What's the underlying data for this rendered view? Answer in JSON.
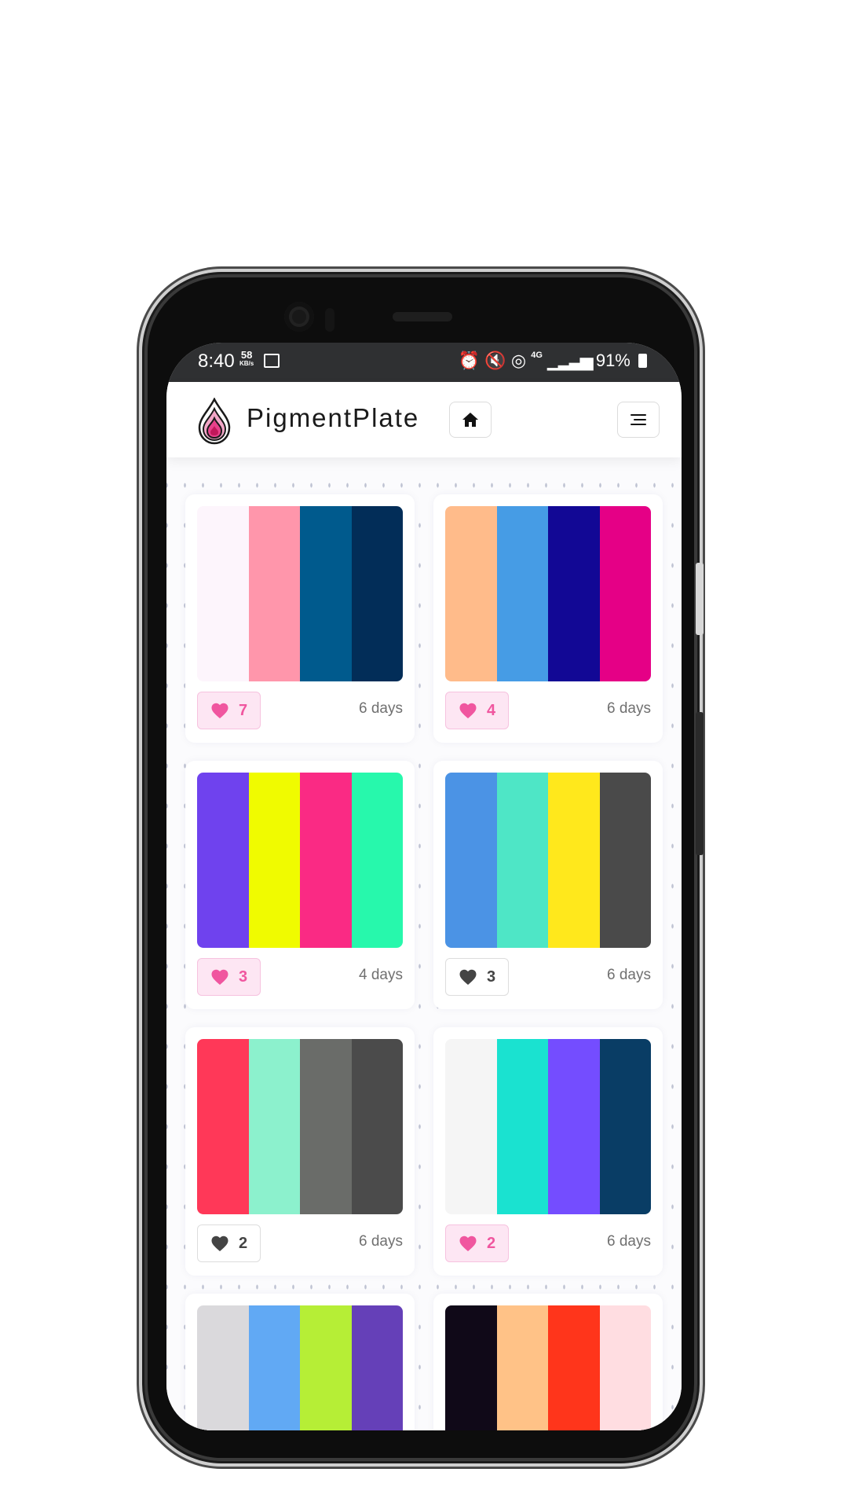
{
  "status_bar": {
    "time": "8:40",
    "net_speed": "58",
    "net_unit": "KB/s",
    "signal": "4G",
    "battery": "91%"
  },
  "navbar": {
    "brand": "PigmentPlate"
  },
  "palettes": [
    {
      "colors": [
        "#fdf5fc",
        "#ff96ab",
        "#005a8d",
        "#022d58"
      ],
      "likes": "7",
      "liked": true,
      "age": "6 days"
    },
    {
      "colors": [
        "#ffbb8a",
        "#469ce5",
        "#120895",
        "#e50086"
      ],
      "likes": "4",
      "liked": true,
      "age": "6 days"
    },
    {
      "colors": [
        "#6f42ee",
        "#f0fb00",
        "#fa2a84",
        "#27f8ac"
      ],
      "likes": "3",
      "liked": true,
      "age": "4 days"
    },
    {
      "colors": [
        "#4b93e5",
        "#4ee6c6",
        "#ffe81c",
        "#4a4a4a"
      ],
      "likes": "3",
      "liked": false,
      "age": "6 days"
    },
    {
      "colors": [
        "#ff3858",
        "#8cf1cd",
        "#6a6c69",
        "#4b4b4b"
      ],
      "likes": "2",
      "liked": false,
      "age": "6 days"
    },
    {
      "colors": [
        "#f5f5f5",
        "#1ae2d0",
        "#744dff",
        "#093d65"
      ],
      "likes": "2",
      "liked": true,
      "age": "6 days"
    },
    {
      "colors": [
        "#dad9dc",
        "#61a9f4",
        "#b6ee36",
        "#6540b8"
      ],
      "likes": "",
      "liked": false,
      "age": ""
    },
    {
      "colors": [
        "#100918",
        "#ffc287",
        "#ff351b",
        "#ffdde1"
      ],
      "likes": "",
      "liked": false,
      "age": ""
    }
  ],
  "colors": {
    "like_active": "#f0569f",
    "like_active_bg": "#fde6f3",
    "statusbar_bg": "#2f3032"
  }
}
